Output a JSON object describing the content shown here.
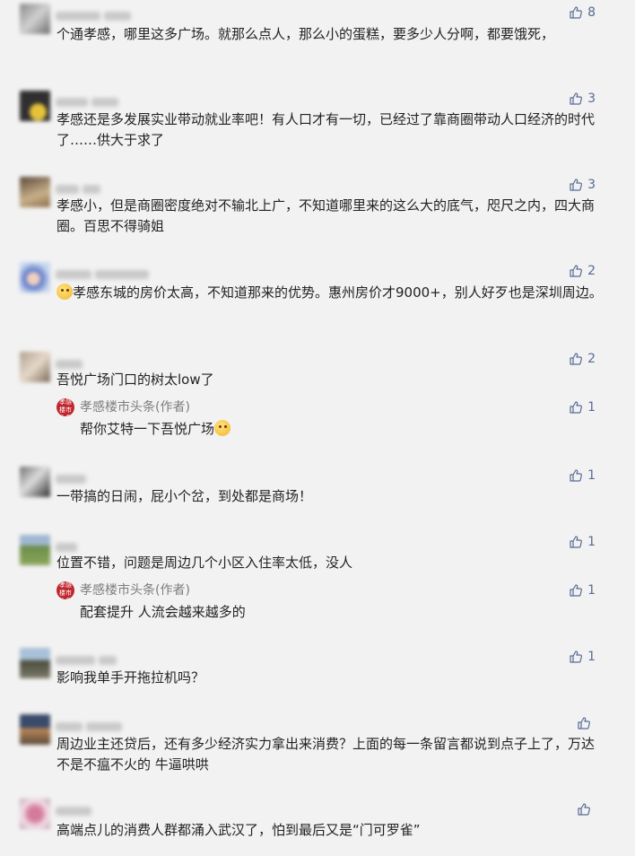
{
  "colors": {
    "like": "#576b95",
    "text": "#222222",
    "author": "#7d7d7d",
    "author_badge": "#c0262d",
    "background": "#f2f2f2"
  },
  "comments": [
    {
      "nick": "",
      "text": "个通孝感，哪里这多广场。就那么点人，那么小的蛋糕，要多少人分啊，都要饿死，",
      "likes": "8"
    },
    {
      "nick": "slow",
      "text": "孝感还是多发展实业带动就业率吧！有人口才有一切，已经过了靠商圈带动人口经济的时代了……供大于求了",
      "likes": "3"
    },
    {
      "nick": "",
      "text": "孝感小，但是商圈密度绝对不输北上广，不知道哪里来的这么大的底气，咫尺之内，四大商圈。百思不得骑姐",
      "likes": "3"
    },
    {
      "nick": "",
      "text": "孝感东城的房价太高，不知道那来的优势。惠州房价才9000+，别人好歹也是深圳周边。",
      "likes": "2",
      "emoji": "grinning-sweat-emoji"
    },
    {
      "nick": "",
      "text": "吾悦广场门口的树太low了",
      "likes": "2",
      "reply": {
        "author": "孝感楼市头条(作者)",
        "badge": "孝感楼市头条",
        "text": "帮你艾特一下吾悦广场",
        "likes": "1",
        "emoji": "thinking-emoji"
      }
    },
    {
      "nick": "",
      "text": "一带搞的日闹，屁小个岔，到处都是商场！",
      "likes": "1"
    },
    {
      "nick": "",
      "text": "位置不错，问题是周边几个小区入住率太低，没人",
      "likes": "1",
      "reply": {
        "author": "孝感楼市头条(作者)",
        "badge": "孝感楼市头条",
        "text": "配套提升 人流会越来越多的",
        "likes": "1"
      }
    },
    {
      "nick": "Talk",
      "text": "影响我单手开拖拉机吗？",
      "likes": "1"
    },
    {
      "nick": "",
      "text": "周边业主还贷后，还有多少经济实力拿出来消费？上面的每一条留言都说到点子上了，万达不是不瘟不火的 牛逼哄哄",
      "likes": ""
    },
    {
      "nick": "",
      "text": "高端点儿的消费人群都涌入武汉了，怕到最后又是“门可罗雀”",
      "likes": ""
    }
  ]
}
